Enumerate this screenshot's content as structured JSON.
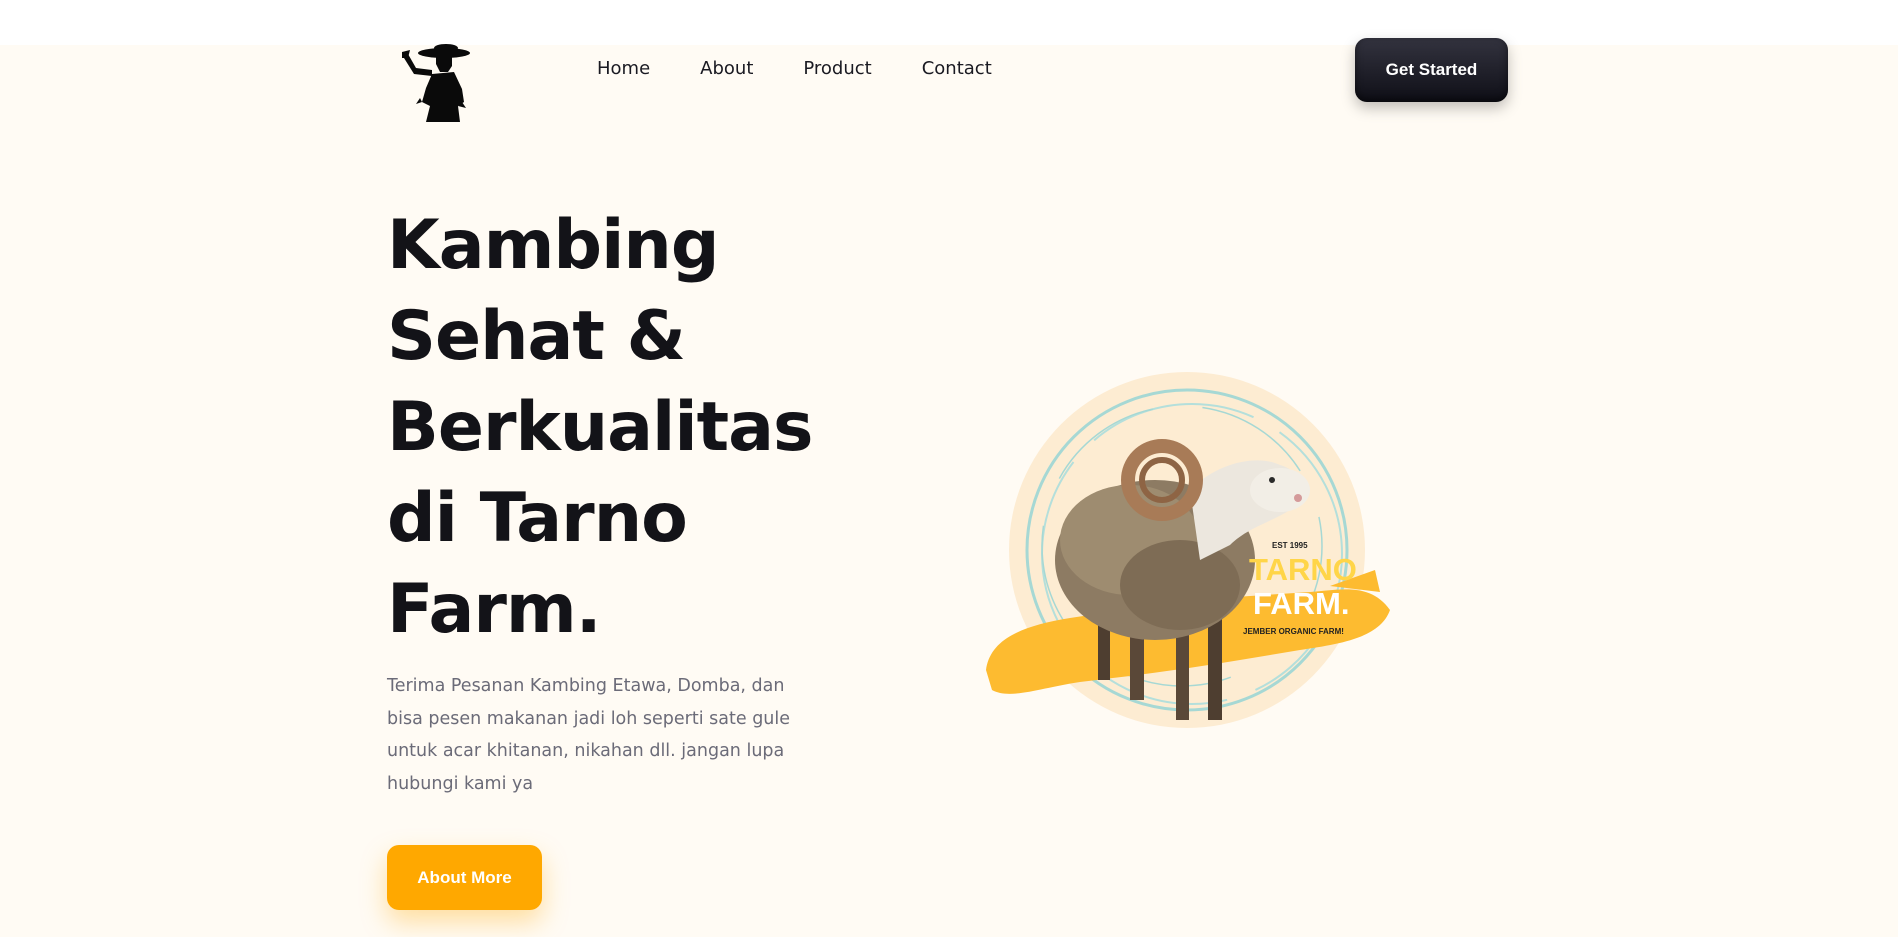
{
  "nav": {
    "items": [
      {
        "label": "Home"
      },
      {
        "label": "About"
      },
      {
        "label": "Product"
      },
      {
        "label": "Contact"
      }
    ],
    "cta_label": "Get Started"
  },
  "hero": {
    "title": "Kambing Sehat & Berkualitas di Tarno Farm.",
    "description": "Terima Pesanan Kambing Etawa, Domba, dan bisa pesen makanan jadi loh seperti sate gule untuk acar khitanan, nikahan dll. jangan lupa hubungi kami ya",
    "button_label": "About More"
  },
  "badge": {
    "est": "EST 1995",
    "name_line1": "TARNO",
    "name_line2": "FARM.",
    "tagline": "JEMBER ORGANIC FARM!"
  },
  "colors": {
    "background": "#fffbf4",
    "accent": "#ffa800",
    "dark_button": "#1a1a24",
    "heading": "#131318",
    "body_text": "#6b6b78"
  },
  "icons": {
    "logo": "farmer-silhouette-logo",
    "hero": "sheep-illustration"
  }
}
